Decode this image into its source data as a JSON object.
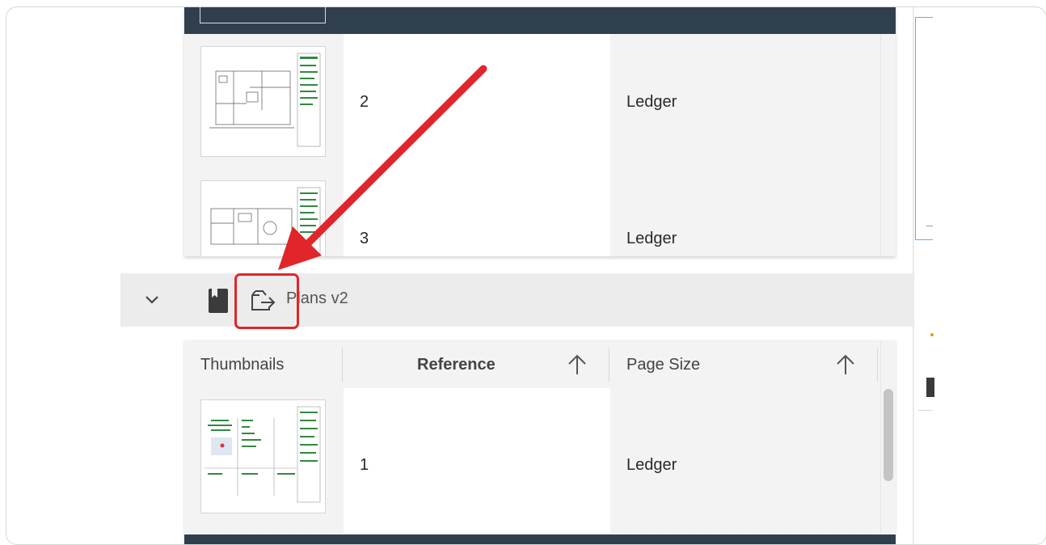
{
  "upper_table": {
    "rows": [
      {
        "reference": "2",
        "page_size": "Ledger"
      },
      {
        "reference": "3",
        "page_size": "Ledger"
      }
    ]
  },
  "group": {
    "title": "Plans v2",
    "icons": [
      "chevron-down-icon",
      "book-icon",
      "publish-export-icon"
    ]
  },
  "lower_table": {
    "headers": {
      "thumbnails": "Thumbnails",
      "reference": "Reference",
      "page_size": "Page Size"
    },
    "rows": [
      {
        "reference": "1",
        "page_size": "Ledger"
      }
    ]
  },
  "annotation": {
    "arrow_color": "#e0262a",
    "highlight_color": "#e0262a"
  }
}
